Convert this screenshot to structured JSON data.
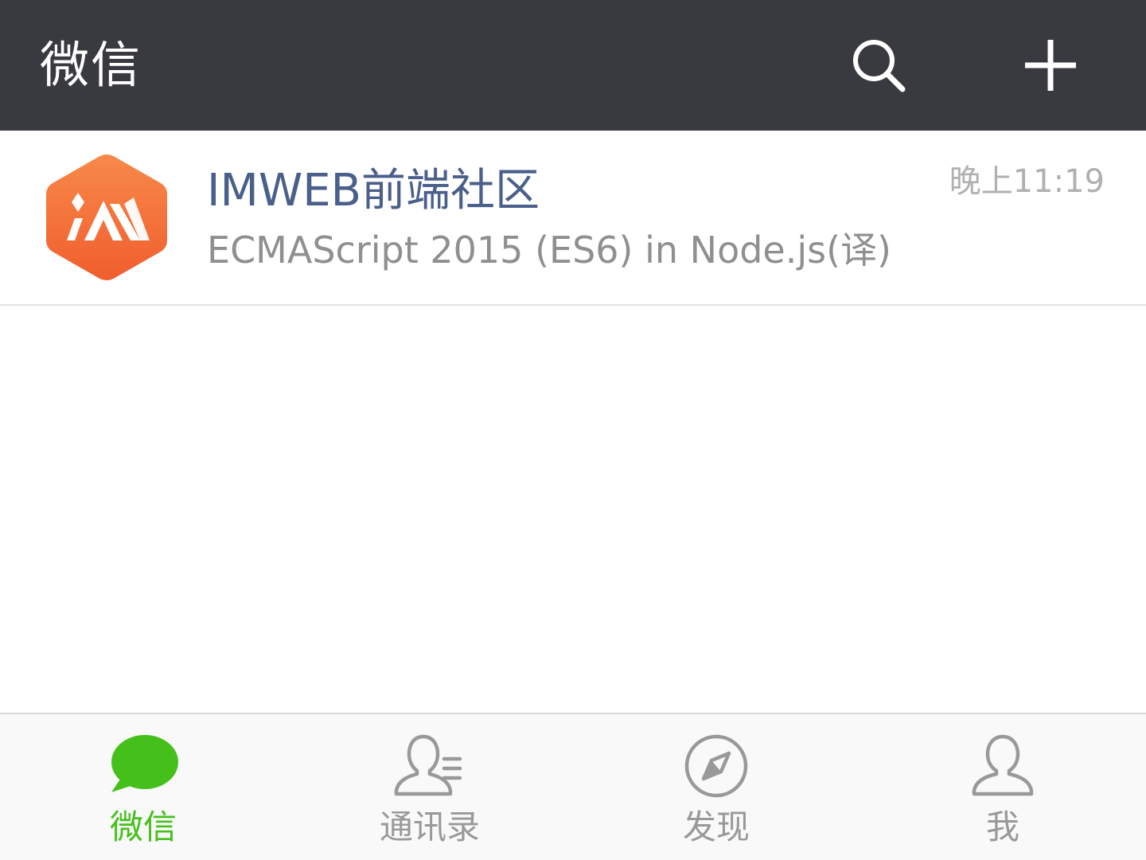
{
  "header": {
    "title": "微信",
    "search_icon": "search-icon",
    "add_icon": "plus-icon",
    "background": "#393a3f"
  },
  "chats": [
    {
      "name": "IMWEB前端社区",
      "preview": "ECMAScript 2015 (ES6) in Node.js(译)",
      "time": "晚上11:19",
      "avatar_icon": "imweb-logo",
      "name_color": "#4a5f8a",
      "avatar_color": "#f26b3a"
    }
  ],
  "tabbar": {
    "active_color": "#45c01a",
    "inactive_color": "#999999",
    "tabs": [
      {
        "label": "微信",
        "icon": "chat-bubble-icon",
        "active": true
      },
      {
        "label": "通讯录",
        "icon": "contacts-icon",
        "active": false
      },
      {
        "label": "发现",
        "icon": "compass-icon",
        "active": false
      },
      {
        "label": "我",
        "icon": "person-icon",
        "active": false
      }
    ]
  }
}
